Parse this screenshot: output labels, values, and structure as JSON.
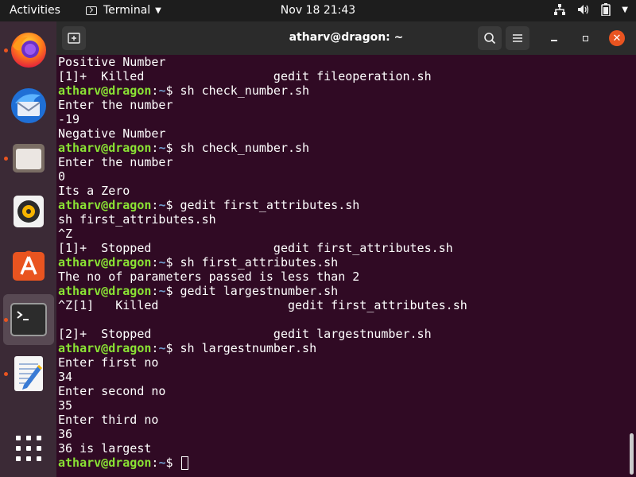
{
  "topbar": {
    "activities_label": "Activities",
    "app_menu_label": "Terminal",
    "clock": "Nov 18  21:43",
    "tray_icons": [
      "network-icon",
      "volume-icon",
      "battery-icon",
      "power-menu-icon"
    ]
  },
  "dock": {
    "items": [
      {
        "name": "firefox",
        "icon": "firefox-icon",
        "running": true,
        "active": false
      },
      {
        "name": "thunderbird",
        "icon": "thunderbird-icon",
        "running": false,
        "active": false
      },
      {
        "name": "files",
        "icon": "files-icon",
        "running": true,
        "active": false
      },
      {
        "name": "rhythmbox",
        "icon": "rhythmbox-icon",
        "running": false,
        "active": false
      },
      {
        "name": "software",
        "icon": "software-center-icon",
        "running": false,
        "active": false
      },
      {
        "name": "terminal",
        "icon": "terminal-icon",
        "running": true,
        "active": true
      },
      {
        "name": "text-editor",
        "icon": "text-editor-icon",
        "running": true,
        "active": false
      },
      {
        "name": "show-apps",
        "icon": "app-grid-icon",
        "running": false,
        "active": false
      }
    ],
    "accent": "#e95420"
  },
  "window": {
    "title": "atharv@dragon: ~"
  },
  "terminal": {
    "user_host": "atharv@dragon",
    "path": "~",
    "lines": [
      {
        "text": "Positive Number"
      },
      {
        "text": "[1]+  Killed                  gedit fileoperation.sh"
      },
      {
        "prompt": true,
        "cmd": "sh check_number.sh"
      },
      {
        "text": "Enter the number"
      },
      {
        "text": "-19"
      },
      {
        "text": "Negative Number"
      },
      {
        "prompt": true,
        "cmd": "sh check_number.sh"
      },
      {
        "text": "Enter the number"
      },
      {
        "text": "0"
      },
      {
        "text": "Its a Zero"
      },
      {
        "prompt": true,
        "cmd": "gedit first_attributes.sh"
      },
      {
        "text": "sh first_attributes.sh"
      },
      {
        "text": "^Z"
      },
      {
        "text": "[1]+  Stopped                 gedit first_attributes.sh"
      },
      {
        "prompt": true,
        "cmd": "sh first_attributes.sh"
      },
      {
        "text": "The no of parameters passed is less than 2"
      },
      {
        "prompt": true,
        "cmd": "gedit largestnumber.sh"
      },
      {
        "text": "^Z[1]   Killed                  gedit first_attributes.sh"
      },
      {
        "text": ""
      },
      {
        "text": "[2]+  Stopped                 gedit largestnumber.sh"
      },
      {
        "prompt": true,
        "cmd": "sh largestnumber.sh"
      },
      {
        "text": "Enter first no"
      },
      {
        "text": "34"
      },
      {
        "text": "Enter second no"
      },
      {
        "text": "35"
      },
      {
        "text": "Enter third no"
      },
      {
        "text": "36"
      },
      {
        "text": "36 is largest"
      },
      {
        "prompt": true,
        "cmd": "",
        "cursor": true
      }
    ],
    "colors": {
      "background": "#300a24",
      "user": "#8ae234",
      "path": "#729fcf",
      "text": "#ffffff"
    }
  }
}
